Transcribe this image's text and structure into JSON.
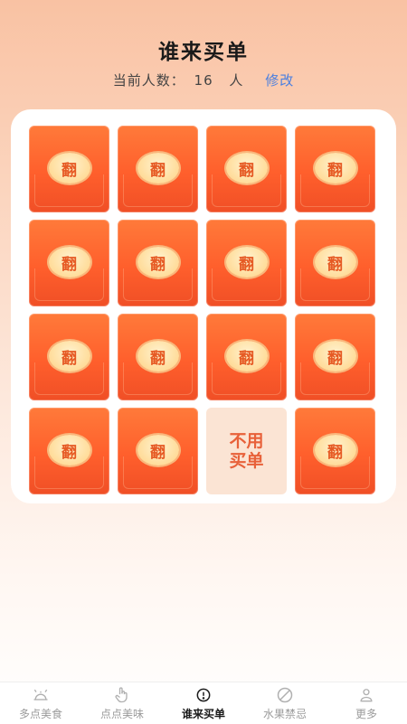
{
  "header": {
    "title": "谁来买单",
    "people_label": "当前人数：",
    "people_count": "16",
    "people_unit": "人",
    "edit_label": "修改"
  },
  "grid": {
    "flip_label": "翻",
    "free_cell_text": "不用买单",
    "free_cell_index": 14
  },
  "tabs": [
    {
      "label": "多点美食",
      "icon": "dining-icon"
    },
    {
      "label": "点点美味",
      "icon": "hand-pointer-icon"
    },
    {
      "label": "谁来买单",
      "icon": "alert-circle-icon",
      "active": true
    },
    {
      "label": "水果禁忌",
      "icon": "forbidden-icon"
    },
    {
      "label": "更多",
      "icon": "user-icon"
    }
  ],
  "colors": {
    "card_orange": "#ff5f2c",
    "coin_text": "#e65a24",
    "edit_link": "#4a7fe0"
  }
}
